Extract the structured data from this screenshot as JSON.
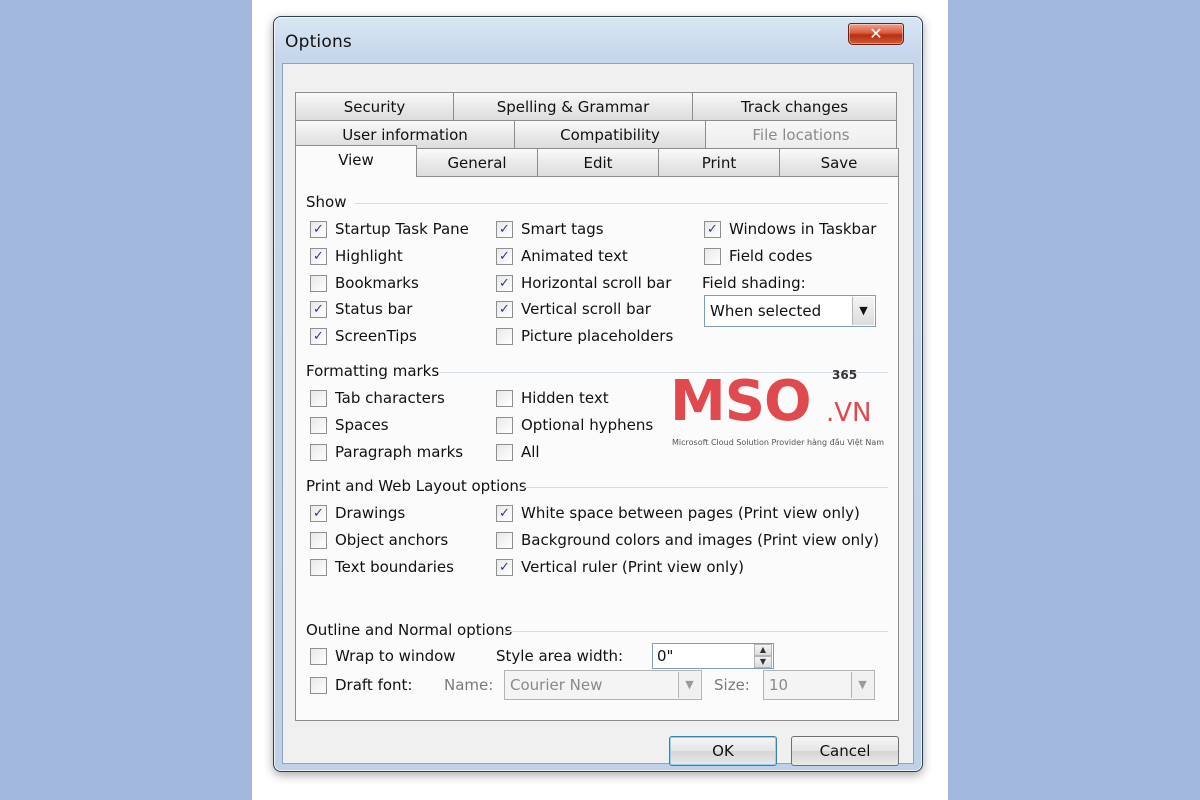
{
  "window": {
    "title": "Options",
    "close_glyph": "✕"
  },
  "tabs": {
    "row1": [
      "Security",
      "Spelling & Grammar",
      "Track changes"
    ],
    "row2": [
      "User information",
      "Compatibility",
      "File locations"
    ],
    "row3": [
      "View",
      "General",
      "Edit",
      "Print",
      "Save"
    ],
    "active": "View",
    "disabled": "File locations"
  },
  "show": {
    "label": "Show",
    "startup_task_pane": "Startup Task Pane",
    "highlight": "Highlight",
    "bookmarks": "Bookmarks",
    "status_bar": "Status bar",
    "screentips": "ScreenTips",
    "smart_tags": "Smart tags",
    "animated_text": "Animated text",
    "horizontal_scroll_bar": "Horizontal scroll bar",
    "vertical_scroll_bar": "Vertical scroll bar",
    "picture_placeholders": "Picture placeholders",
    "windows_in_taskbar": "Windows in Taskbar",
    "field_codes": "Field codes",
    "field_shading_label": "Field shading:",
    "field_shading_value": "When selected"
  },
  "formatting": {
    "label": "Formatting marks",
    "tab_characters": "Tab characters",
    "spaces": "Spaces",
    "paragraph_marks": "Paragraph marks",
    "hidden_text": "Hidden text",
    "optional_hyphens": "Optional hyphens",
    "all": "All"
  },
  "print_web": {
    "label": "Print and Web Layout options",
    "drawings": "Drawings",
    "object_anchors": "Object anchors",
    "text_boundaries": "Text boundaries",
    "white_space": "White space between pages (Print view only)",
    "background_colors": "Background colors and images (Print view only)",
    "vertical_ruler": "Vertical ruler (Print view only)"
  },
  "outline": {
    "label": "Outline and Normal options",
    "wrap_to_window": "Wrap to window",
    "draft_font": "Draft font:",
    "style_area_label": "Style area width:",
    "style_area_value": "0\"",
    "name_label": "Name:",
    "name_value": "Courier New",
    "size_label": "Size:",
    "size_value": "10"
  },
  "checked": {
    "startup_task_pane": true,
    "highlight": true,
    "bookmarks": false,
    "status_bar": true,
    "screentips": true,
    "smart_tags": true,
    "animated_text": true,
    "horizontal_scroll_bar": true,
    "vertical_scroll_bar": true,
    "picture_placeholders": false,
    "windows_in_taskbar": true,
    "field_codes": false,
    "tab_characters": false,
    "spaces": false,
    "paragraph_marks": false,
    "hidden_text": false,
    "optional_hyphens": false,
    "all": false,
    "drawings": true,
    "object_anchors": false,
    "text_boundaries": false,
    "white_space": true,
    "background_colors": false,
    "vertical_ruler": true,
    "wrap_to_window": false,
    "draft_font": false
  },
  "buttons": {
    "ok": "OK",
    "cancel": "Cancel"
  },
  "watermark": {
    "brand": "MSO",
    "suffix": ".VN",
    "superscript": "365",
    "tagline": "Microsoft Cloud Solution Provider hàng đầu Việt Nam"
  },
  "colors": {
    "page_bg": "#a2b8dc",
    "brand_red": "#e04a4f",
    "check": "#2c3b8f"
  }
}
